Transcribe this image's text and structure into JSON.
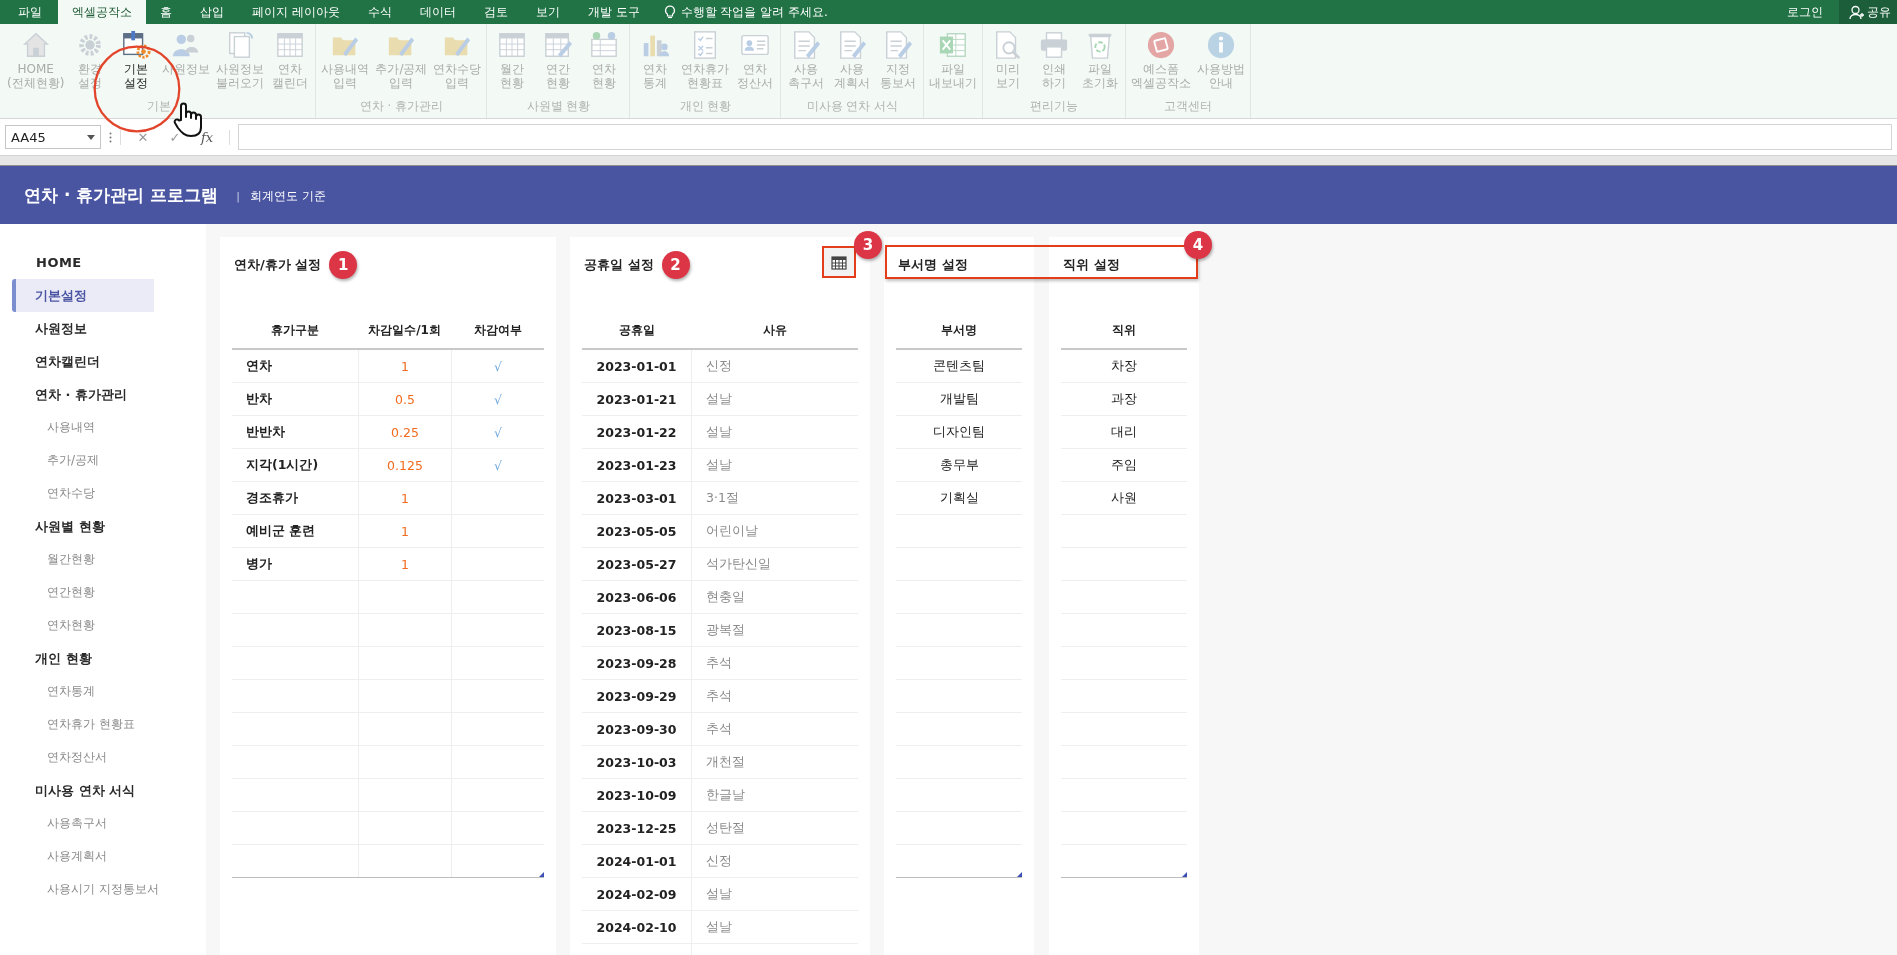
{
  "menu_tabs": [
    {
      "label": "파일",
      "selected": false
    },
    {
      "label": "엑셀공작소",
      "selected": true
    },
    {
      "label": "홈",
      "selected": false
    },
    {
      "label": "삽입",
      "selected": false
    },
    {
      "label": "페이지 레이아웃",
      "selected": false
    },
    {
      "label": "수식",
      "selected": false
    },
    {
      "label": "데이터",
      "selected": false
    },
    {
      "label": "검토",
      "selected": false
    },
    {
      "label": "보기",
      "selected": false
    },
    {
      "label": "개발 도구",
      "selected": false
    }
  ],
  "tell_me": "수행할 작업을 알려 주세요.",
  "account": {
    "login": "로그인",
    "share": "공유"
  },
  "ribbon": {
    "groups": [
      {
        "label": "기본",
        "buttons": [
          {
            "lines": [
              "HOME",
              "(전체현황)"
            ],
            "selected": false
          },
          {
            "lines": [
              "환경",
              "설정"
            ],
            "selected": false
          },
          {
            "lines": [
              "기본",
              "설정"
            ],
            "selected": true
          },
          {
            "lines": [
              "사원정보"
            ],
            "selected": false
          },
          {
            "lines": [
              "사원정보",
              "불러오기"
            ],
            "selected": false
          },
          {
            "lines": [
              "연차",
              "캘린더"
            ],
            "selected": false
          }
        ]
      },
      {
        "label": "연차 · 휴가관리",
        "buttons": [
          {
            "lines": [
              "사용내역",
              "입력"
            ],
            "selected": false
          },
          {
            "lines": [
              "추가/공제",
              "입력"
            ],
            "selected": false
          },
          {
            "lines": [
              "연차수당",
              "입력"
            ],
            "selected": false
          }
        ]
      },
      {
        "label": "사원별 현황",
        "buttons": [
          {
            "lines": [
              "월간",
              "현황"
            ],
            "selected": false
          },
          {
            "lines": [
              "연간",
              "현황"
            ],
            "selected": false
          },
          {
            "lines": [
              "연차",
              "현황"
            ],
            "selected": false
          }
        ]
      },
      {
        "label": "개인 현황",
        "buttons": [
          {
            "lines": [
              "연차",
              "통계"
            ],
            "selected": false
          },
          {
            "lines": [
              "연차휴가",
              "현황표"
            ],
            "selected": false
          },
          {
            "lines": [
              "연차",
              "정산서"
            ],
            "selected": false
          }
        ]
      },
      {
        "label": "미사용 연차 서식",
        "buttons": [
          {
            "lines": [
              "사용",
              "촉구서"
            ],
            "selected": false
          },
          {
            "lines": [
              "사용",
              "계획서"
            ],
            "selected": false
          },
          {
            "lines": [
              "지정",
              "통보서"
            ],
            "selected": false
          }
        ]
      },
      {
        "buttons": [
          {
            "lines": [
              "파일",
              "내보내기"
            ],
            "selected": false
          }
        ]
      },
      {
        "label": "편리기능",
        "buttons": [
          {
            "lines": [
              "미리",
              "보기"
            ],
            "selected": false
          },
          {
            "lines": [
              "인쇄",
              "하기"
            ],
            "selected": false
          },
          {
            "lines": [
              "파일",
              "초기화"
            ],
            "selected": false
          }
        ]
      },
      {
        "label": "고객센터",
        "buttons": [
          {
            "lines": [
              "예스폼",
              "엑셀공작소"
            ],
            "selected": false
          },
          {
            "lines": [
              "사용방법",
              "안내"
            ],
            "selected": false
          }
        ]
      }
    ]
  },
  "formula_bar": {
    "name_box": "AA45",
    "cancel": "✕",
    "enter": "✓",
    "fx": "fx"
  },
  "header": {
    "title": "연차 · 휴가관리 프로그램",
    "separator": "|",
    "subtitle": "회계연도 기준"
  },
  "sidebar": {
    "items": [
      {
        "label": "HOME",
        "kind": "home",
        "selected": false
      },
      {
        "label": "기본설정",
        "kind": "section",
        "selected": true
      },
      {
        "label": "사원정보",
        "kind": "section",
        "selected": false
      },
      {
        "label": "연차캘린더",
        "kind": "section",
        "selected": false
      },
      {
        "label": "연차 · 휴가관리",
        "kind": "section",
        "selected": false
      },
      {
        "label": "사용내역",
        "kind": "sub",
        "selected": false
      },
      {
        "label": "추가/공제",
        "kind": "sub",
        "selected": false
      },
      {
        "label": "연차수당",
        "kind": "sub",
        "selected": false
      },
      {
        "label": "사원별 현황",
        "kind": "section",
        "selected": false
      },
      {
        "label": "월간현황",
        "kind": "sub",
        "selected": false
      },
      {
        "label": "연간현황",
        "kind": "sub",
        "selected": false
      },
      {
        "label": "연차현황",
        "kind": "sub",
        "selected": false
      },
      {
        "label": "개인 현황",
        "kind": "section",
        "selected": false
      },
      {
        "label": "연차통계",
        "kind": "sub",
        "selected": false
      },
      {
        "label": "연차휴가 현황표",
        "kind": "sub",
        "selected": false
      },
      {
        "label": "연차정산서",
        "kind": "sub",
        "selected": false
      },
      {
        "label": "미사용 연차 서식",
        "kind": "section",
        "selected": false
      },
      {
        "label": "사용촉구서",
        "kind": "sub",
        "selected": false
      },
      {
        "label": "사용계획서",
        "kind": "sub",
        "selected": false
      },
      {
        "label": "사용시기 지정통보서",
        "kind": "sub",
        "selected": false
      }
    ]
  },
  "leave_settings": {
    "title": "연차/휴가 설정",
    "badge": "1",
    "columns": [
      "휴가구분",
      "차감일수/1회",
      "차감여부"
    ],
    "rows": [
      {
        "type": "연차",
        "days": "1",
        "deduct": "√"
      },
      {
        "type": "반차",
        "days": "0.5",
        "deduct": "√"
      },
      {
        "type": "반반차",
        "days": "0.25",
        "deduct": "√"
      },
      {
        "type": "지각(1시간)",
        "days": "0.125",
        "deduct": "√"
      },
      {
        "type": "경조휴가",
        "days": "1"
      },
      {
        "type": "예비군 훈련",
        "days": "1"
      },
      {
        "type": "병가",
        "days": "1"
      }
    ]
  },
  "holidays": {
    "title": "공휴일 설정",
    "badge": "2",
    "calendar_badge": "3",
    "columns": [
      "공휴일",
      "사유"
    ],
    "rows": [
      {
        "date": "2023-01-01",
        "reason": "신정"
      },
      {
        "date": "2023-01-21",
        "reason": "설날"
      },
      {
        "date": "2023-01-22",
        "reason": "설날"
      },
      {
        "date": "2023-01-23",
        "reason": "설날"
      },
      {
        "date": "2023-03-01",
        "reason": "3·1절"
      },
      {
        "date": "2023-05-05",
        "reason": "어린이날"
      },
      {
        "date": "2023-05-27",
        "reason": "석가탄신일"
      },
      {
        "date": "2023-06-06",
        "reason": "현충일"
      },
      {
        "date": "2023-08-15",
        "reason": "광복절"
      },
      {
        "date": "2023-09-28",
        "reason": "추석"
      },
      {
        "date": "2023-09-29",
        "reason": "추석"
      },
      {
        "date": "2023-09-30",
        "reason": "추석"
      },
      {
        "date": "2023-10-03",
        "reason": "개천절"
      },
      {
        "date": "2023-10-09",
        "reason": "한글날"
      },
      {
        "date": "2023-12-25",
        "reason": "성탄절"
      },
      {
        "date": "2024-01-01",
        "reason": "신정"
      },
      {
        "date": "2024-02-09",
        "reason": "설날"
      },
      {
        "date": "2024-02-10",
        "reason": "설날"
      }
    ]
  },
  "name_settings_badge": "4",
  "departments": {
    "title": "부서명 설정",
    "column": "부서명",
    "rows": [
      "콘텐츠팀",
      "개발팀",
      "디자인팀",
      "총무부",
      "기획실"
    ]
  },
  "positions": {
    "title": "직위 설정",
    "column": "직위",
    "rows": [
      "차장",
      "과장",
      "대리",
      "주임",
      "사원"
    ]
  }
}
